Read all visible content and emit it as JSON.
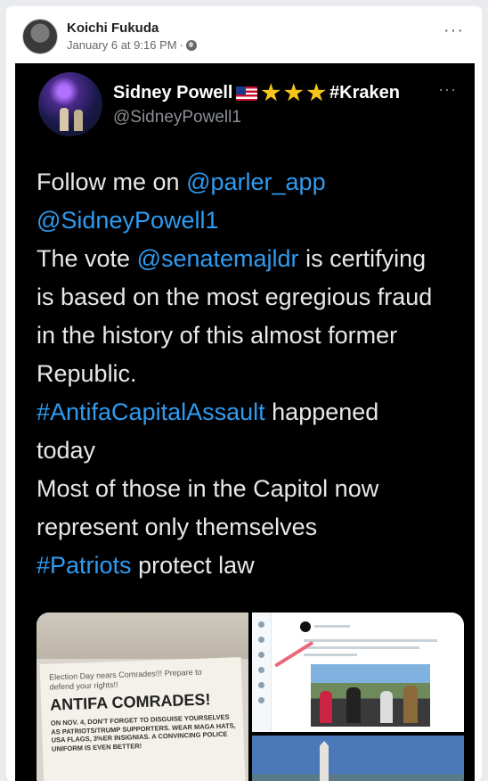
{
  "post": {
    "author": "Koichi Fukuda",
    "timestamp": "January 6 at 9:16 PM",
    "separator": "·",
    "more": "···",
    "privacy_icon": "globe-icon"
  },
  "tweet": {
    "display_name": "Sidney Powell",
    "flag": "🇺🇸",
    "stars": [
      "★",
      "★",
      "★"
    ],
    "hashtag_in_name": "#Kraken",
    "handle": "@SidneyPowell1",
    "more": "···",
    "link_color": "#2f9bf0",
    "lines": [
      {
        "parts": [
          {
            "text": "Follow me on ",
            "link": false
          },
          {
            "text": "@parler_app",
            "link": true
          }
        ]
      },
      {
        "parts": [
          {
            "text": "@SidneyPowell1",
            "link": true
          }
        ]
      },
      {
        "parts": [
          {
            "text": "The vote ",
            "link": false
          },
          {
            "text": "@senatemajldr",
            "link": true
          },
          {
            "text": " is certifying",
            "link": false
          }
        ]
      },
      {
        "parts": [
          {
            "text": "is based on the most egregious fraud",
            "link": false
          }
        ]
      },
      {
        "parts": [
          {
            "text": "in the history of this almost former",
            "link": false
          }
        ]
      },
      {
        "parts": [
          {
            "text": "Republic.",
            "link": false
          }
        ]
      },
      {
        "parts": [
          {
            "text": "#AntifaCapitalAssault",
            "link": true
          },
          {
            "text": " happened",
            "link": false
          }
        ]
      },
      {
        "parts": [
          {
            "text": "today",
            "link": false
          }
        ]
      },
      {
        "parts": [
          {
            "text": "Most of those in the Capitol now",
            "link": false
          }
        ]
      },
      {
        "parts": [
          {
            "text": "represent only themselves",
            "link": false
          }
        ]
      },
      {
        "parts": [
          {
            "text": "#Patriots",
            "link": true
          },
          {
            "text": " protect law",
            "link": false
          }
        ]
      }
    ]
  },
  "media": {
    "flyer": {
      "intro": "Election Day nears Comrades!!! Prepare to defend your rights!!",
      "headline": "ANTIFA COMRADES!",
      "body": "ON NOV. 4, DON'T FORGET TO DISGUISE YOURSELVES AS PATRIOTS/TRUMP SUPPORTERS. WEAR MAGA HATS, USA FLAGS, 3%ER INSIGNIAS. A CONVINCING POLICE UNIFORM IS EVEN BETTER!"
    }
  }
}
